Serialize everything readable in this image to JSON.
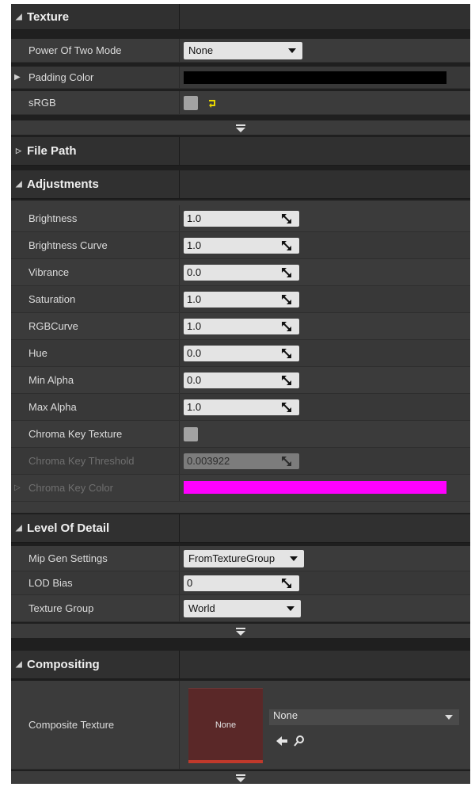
{
  "sections": {
    "texture": {
      "title": "Texture"
    },
    "file_path": {
      "title": "File Path"
    },
    "adjustments": {
      "title": "Adjustments"
    },
    "level_of_detail": {
      "title": "Level Of Detail"
    },
    "compositing": {
      "title": "Compositing"
    }
  },
  "texture": {
    "power_of_two": {
      "label": "Power Of Two Mode",
      "value": "None"
    },
    "padding_color": {
      "label": "Padding Color",
      "color": "#000000"
    },
    "srgb": {
      "label": "sRGB",
      "checked": false
    }
  },
  "adjustments": {
    "brightness": {
      "label": "Brightness",
      "value": "1.0"
    },
    "brightness_curve": {
      "label": "Brightness Curve",
      "value": "1.0"
    },
    "vibrance": {
      "label": "Vibrance",
      "value": "0.0"
    },
    "saturation": {
      "label": "Saturation",
      "value": "1.0"
    },
    "rgb_curve": {
      "label": "RGBCurve",
      "value": "1.0"
    },
    "hue": {
      "label": "Hue",
      "value": "0.0"
    },
    "min_alpha": {
      "label": "Min Alpha",
      "value": "0.0"
    },
    "max_alpha": {
      "label": "Max Alpha",
      "value": "1.0"
    },
    "chroma_key_texture": {
      "label": "Chroma Key Texture",
      "checked": false
    },
    "chroma_key_threshold": {
      "label": "Chroma Key Threshold",
      "value": "0.003922"
    },
    "chroma_key_color": {
      "label": "Chroma Key Color",
      "color": "#ff00ff"
    }
  },
  "lod": {
    "mip_gen": {
      "label": "Mip Gen Settings",
      "value": "FromTextureGroup"
    },
    "lod_bias": {
      "label": "LOD Bias",
      "value": "0"
    },
    "texture_group": {
      "label": "Texture Group",
      "value": "World"
    }
  },
  "compositing": {
    "composite_texture": {
      "label": "Composite Texture",
      "thumb_text": "None",
      "value": "None"
    }
  },
  "colors": {
    "panel_bg": "#1f1f1f",
    "row_bg": "#3b3b3b",
    "field_bg": "#e4e4e4",
    "reset_arrow": "#e9d700"
  },
  "icons": {
    "expand_open": "triangle-down-right",
    "expand_closed": "triangle-right-outline",
    "drag": "diagonal-drag-arrows",
    "advanced": "chevron-down-bar",
    "use_selected": "left-arrow",
    "browse": "magnifier"
  }
}
